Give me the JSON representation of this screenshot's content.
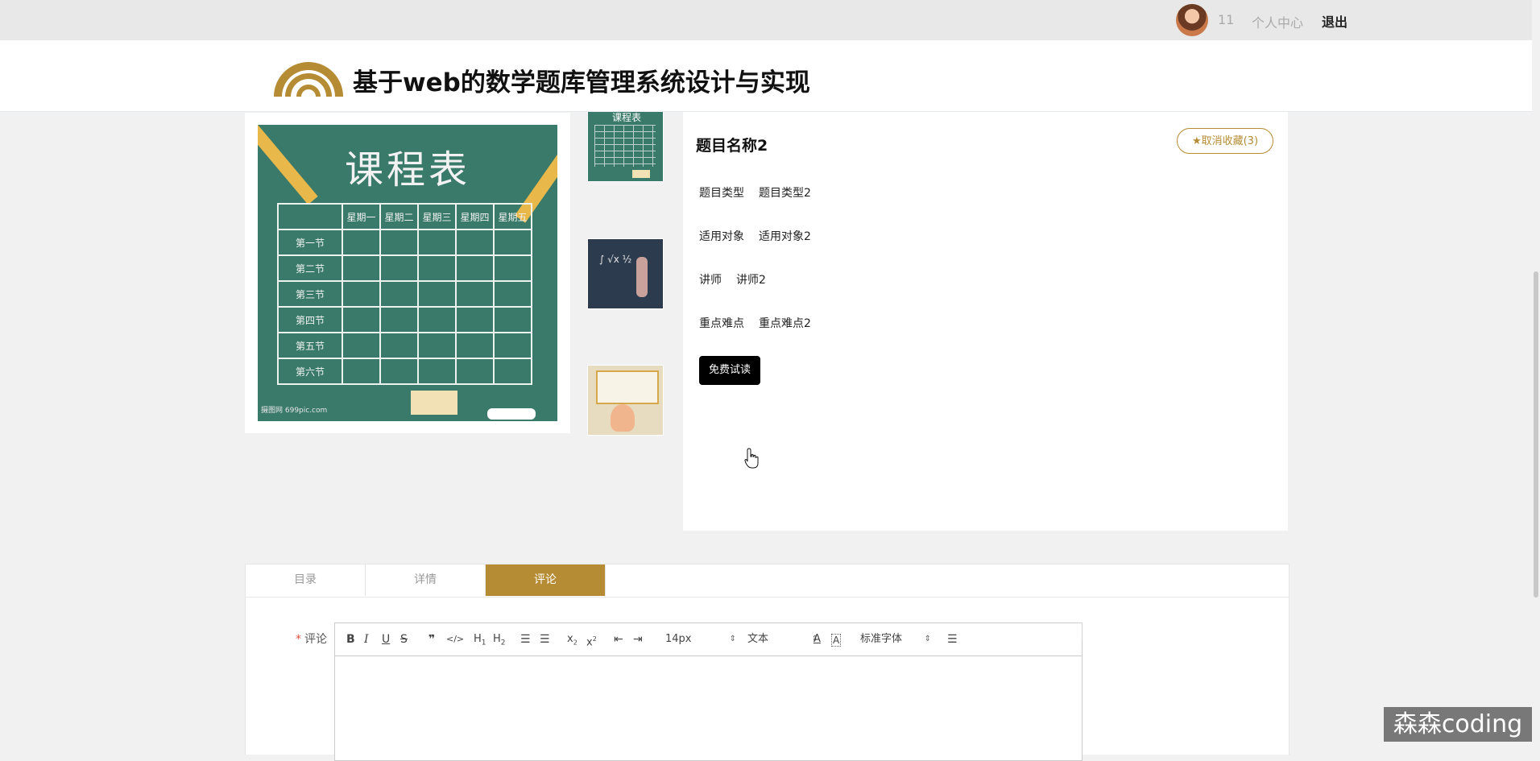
{
  "topbar": {
    "username": "11",
    "user_center": "个人中心",
    "logout": "退出"
  },
  "header": {
    "site_title": "基于web的数学题库管理系统设计与实现",
    "brand_color": "#b58b33"
  },
  "gallery": {
    "main_image": {
      "title": "课程表",
      "weekdays": [
        "星期一",
        "星期二",
        "星期三",
        "星期四",
        "星期五"
      ],
      "periods": [
        "第一节",
        "第二节",
        "第三节",
        "第四节",
        "第五节",
        "第六节"
      ],
      "credit": "摄图网 699pic.com"
    },
    "thumb1_title": "课程表"
  },
  "detail": {
    "title": "题目名称2",
    "collect_button": "★取消收藏(3)",
    "fields": [
      {
        "label": "题目类型",
        "value": "题目类型2"
      },
      {
        "label": "适用对象",
        "value": "适用对象2"
      },
      {
        "label": "讲师",
        "value": "讲师2"
      },
      {
        "label": "重点难点",
        "value": "重点难点2"
      }
    ],
    "trial_button": "免费试读"
  },
  "tabs": [
    {
      "label": "目录",
      "active": false
    },
    {
      "label": "详情",
      "active": false
    },
    {
      "label": "评论",
      "active": true
    }
  ],
  "comment": {
    "required_mark": "*",
    "label": "评论",
    "toolbar": {
      "font_size": "14px",
      "paragraph": "文本",
      "font_family": "标准字体"
    }
  },
  "watermark": "森森coding"
}
